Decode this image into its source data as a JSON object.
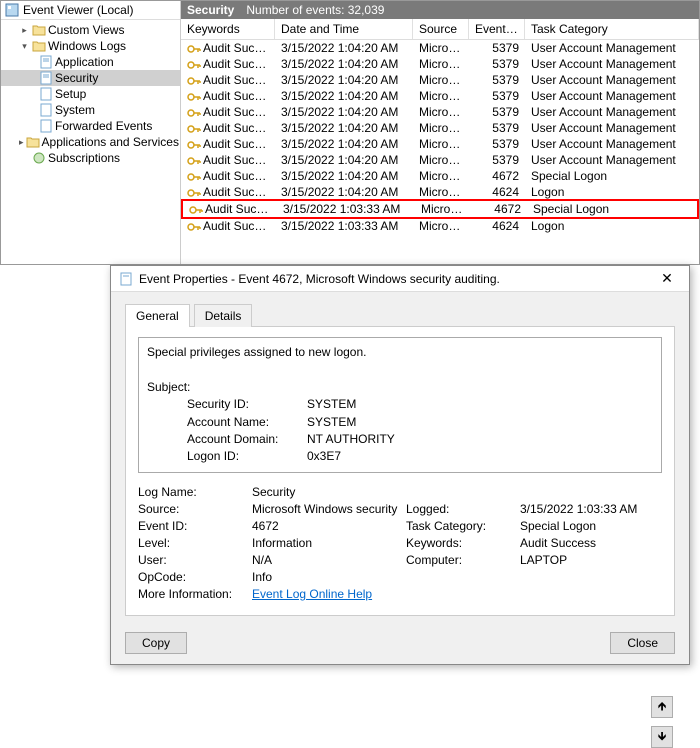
{
  "tree": {
    "root": "Event Viewer (Local)",
    "custom_views": "Custom Views",
    "windows_logs": "Windows Logs",
    "app": "Application",
    "security": "Security",
    "setup": "Setup",
    "system": "System",
    "forwarded": "Forwarded Events",
    "services": "Applications and Services Lo",
    "subs": "Subscriptions"
  },
  "list": {
    "title_label": "Security",
    "count_label": "Number of events: 32,039",
    "columns": {
      "kw": "Keywords",
      "dt": "Date and Time",
      "src": "Source",
      "id": "Event ID",
      "tc": "Task Category"
    },
    "rows": [
      {
        "kw": "Audit Succe...",
        "dt": "3/15/2022 1:04:20 AM",
        "src": "Micros...",
        "id": "5379",
        "tc": "User Account Management"
      },
      {
        "kw": "Audit Succe...",
        "dt": "3/15/2022 1:04:20 AM",
        "src": "Micros...",
        "id": "5379",
        "tc": "User Account Management"
      },
      {
        "kw": "Audit Succe...",
        "dt": "3/15/2022 1:04:20 AM",
        "src": "Micros...",
        "id": "5379",
        "tc": "User Account Management"
      },
      {
        "kw": "Audit Succe...",
        "dt": "3/15/2022 1:04:20 AM",
        "src": "Micros...",
        "id": "5379",
        "tc": "User Account Management"
      },
      {
        "kw": "Audit Succe...",
        "dt": "3/15/2022 1:04:20 AM",
        "src": "Micros...",
        "id": "5379",
        "tc": "User Account Management"
      },
      {
        "kw": "Audit Succe...",
        "dt": "3/15/2022 1:04:20 AM",
        "src": "Micros...",
        "id": "5379",
        "tc": "User Account Management"
      },
      {
        "kw": "Audit Succe...",
        "dt": "3/15/2022 1:04:20 AM",
        "src": "Micros...",
        "id": "5379",
        "tc": "User Account Management"
      },
      {
        "kw": "Audit Succe...",
        "dt": "3/15/2022 1:04:20 AM",
        "src": "Micros...",
        "id": "5379",
        "tc": "User Account Management"
      },
      {
        "kw": "Audit Succe...",
        "dt": "3/15/2022 1:04:20 AM",
        "src": "Micros...",
        "id": "4672",
        "tc": "Special Logon"
      },
      {
        "kw": "Audit Succe...",
        "dt": "3/15/2022 1:04:20 AM",
        "src": "Micros...",
        "id": "4624",
        "tc": "Logon"
      },
      {
        "kw": "Audit Succe...",
        "dt": "3/15/2022 1:03:33 AM",
        "src": "Micros...",
        "id": "4672",
        "tc": "Special Logon",
        "hl": true
      },
      {
        "kw": "Audit Succe...",
        "dt": "3/15/2022 1:03:33 AM",
        "src": "Micros...",
        "id": "4624",
        "tc": "Logon"
      }
    ]
  },
  "dialog": {
    "title": "Event Properties - Event 4672, Microsoft Windows security auditing.",
    "tabs": {
      "general": "General",
      "details": "Details"
    },
    "msg_line1": "Special privileges assigned to new logon.",
    "msg_subject": "Subject:",
    "subj": {
      "sid_l": "Security ID:",
      "sid_v": "SYSTEM",
      "acc_l": "Account Name:",
      "acc_v": "SYSTEM",
      "dom_l": "Account Domain:",
      "dom_v": "NT AUTHORITY",
      "lid_l": "Logon ID:",
      "lid_v": "0x3E7"
    },
    "fields": {
      "logname_l": "Log Name:",
      "logname_v": "Security",
      "source_l": "Source:",
      "source_v": "Microsoft Windows security",
      "logged_l": "Logged:",
      "logged_v": "3/15/2022 1:03:33 AM",
      "eventid_l": "Event ID:",
      "eventid_v": "4672",
      "taskcat_l": "Task Category:",
      "taskcat_v": "Special Logon",
      "level_l": "Level:",
      "level_v": "Information",
      "keywords_l": "Keywords:",
      "keywords_v": "Audit Success",
      "user_l": "User:",
      "user_v": "N/A",
      "computer_l": "Computer:",
      "computer_v": "LAPTOP",
      "opcode_l": "OpCode:",
      "opcode_v": "Info",
      "more_l": "More Information:",
      "more_v": "Event Log Online Help"
    },
    "copy": "Copy",
    "close": "Close"
  }
}
